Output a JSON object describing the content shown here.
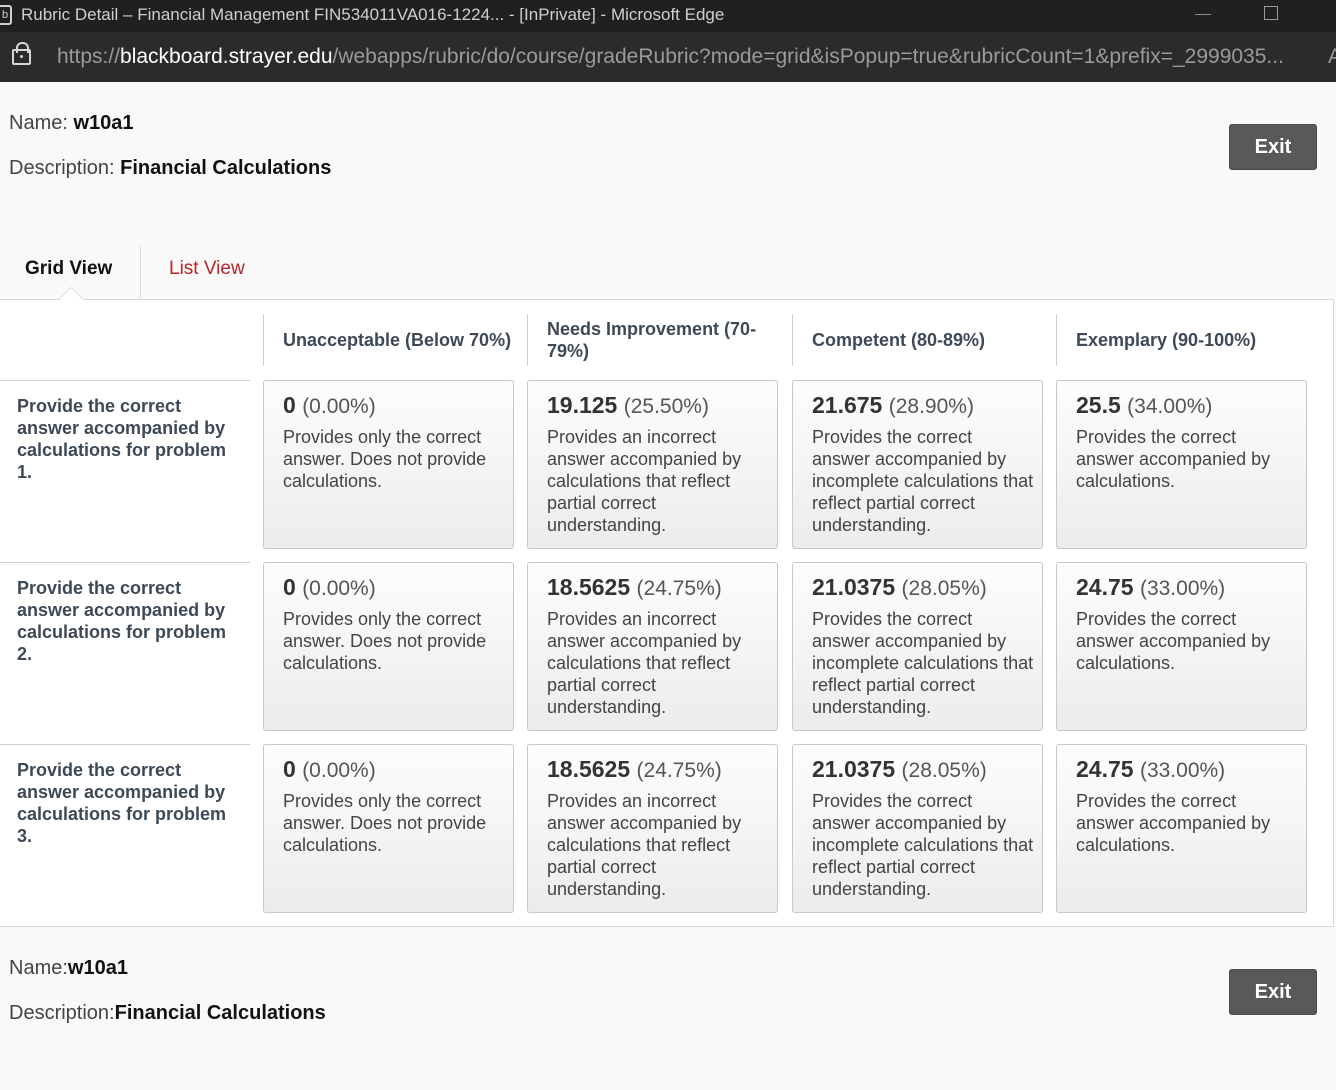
{
  "window": {
    "title": "Rubric Detail – Financial Management FIN534011VA016-1224... - [InPrivate] - Microsoft Edge",
    "app_icon": "b"
  },
  "address": {
    "url_prefix": "https://",
    "url_host": "blackboard.strayer.edu",
    "url_path": "/webapps/rubric/do/course/gradeRubric?mode=grid&isPopup=true&rubricCount=1&prefix=_2999035...",
    "overflow": "A"
  },
  "header": {
    "name_label": "Name: ",
    "name_value": "w10a1",
    "desc_label": "Description: ",
    "desc_value": "Financial Calculations",
    "exit_label": "Exit"
  },
  "tabs": {
    "grid": "Grid View",
    "list": "List View"
  },
  "columns": [
    "Unacceptable (Below 70%)",
    "Needs Improvement (70-79%)",
    "Competent (80-89%)",
    "Exemplary (90-100%)"
  ],
  "rows": [
    {
      "title": "Provide the correct answer accompanied by calculations for problem 1.",
      "cells": [
        {
          "score": "0",
          "pct": "(0.00%)",
          "desc": "Provides only the correct answer. Does not provide calculations."
        },
        {
          "score": "19.125",
          "pct": "(25.50%)",
          "desc": "Provides an incorrect answer accompanied by calculations that reflect partial correct understanding."
        },
        {
          "score": "21.675",
          "pct": "(28.90%)",
          "desc": "Provides the correct answer accompanied by incomplete calculations that reflect partial correct understanding."
        },
        {
          "score": "25.5",
          "pct": "(34.00%)",
          "desc": "Provides the correct answer accompanied by calculations."
        }
      ]
    },
    {
      "title": "Provide the correct answer accompanied by calculations for problem 2.",
      "cells": [
        {
          "score": "0",
          "pct": "(0.00%)",
          "desc": "Provides only the correct answer. Does not provide calculations."
        },
        {
          "score": "18.5625",
          "pct": "(24.75%)",
          "desc": "Provides an incorrect answer accompanied by calculations that reflect partial correct understanding."
        },
        {
          "score": "21.0375",
          "pct": "(28.05%)",
          "desc": "Provides the correct answer accompanied by incomplete calculations that reflect partial correct understanding."
        },
        {
          "score": "24.75",
          "pct": "(33.00%)",
          "desc": "Provides the correct answer accompanied by calculations."
        }
      ]
    },
    {
      "title": "Provide the correct answer accompanied by calculations for problem 3.",
      "cells": [
        {
          "score": "0",
          "pct": "(0.00%)",
          "desc": "Provides only the correct answer. Does not provide calculations."
        },
        {
          "score": "18.5625",
          "pct": "(24.75%)",
          "desc": "Provides an incorrect answer accompanied by calculations that reflect partial correct understanding."
        },
        {
          "score": "21.0375",
          "pct": "(28.05%)",
          "desc": "Provides the correct answer accompanied by incomplete calculations that reflect partial correct understanding."
        },
        {
          "score": "24.75",
          "pct": "(33.00%)",
          "desc": "Provides the correct answer accompanied by calculations."
        }
      ]
    }
  ],
  "footer": {
    "name_label": "Name:",
    "name_value": "w10a1",
    "desc_label": "Description:",
    "desc_value": "Financial Calculations",
    "exit_label": "Exit"
  }
}
